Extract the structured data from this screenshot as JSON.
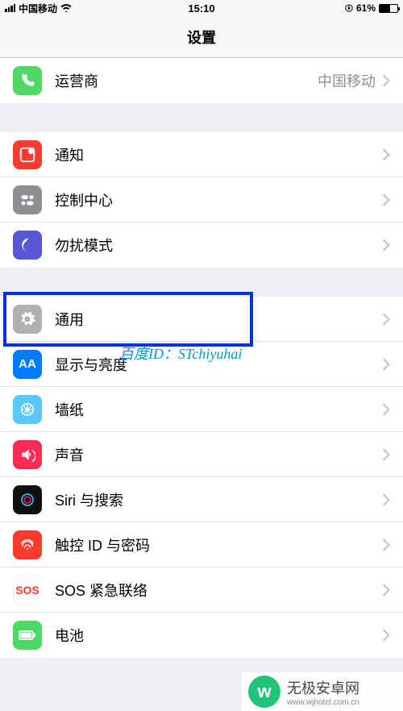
{
  "status": {
    "carrier": "中国移动",
    "time": "15:10",
    "battery_pct": "61%"
  },
  "header": {
    "title": "设置"
  },
  "group1": {
    "carrier": {
      "label": "运营商",
      "detail": "中国移动"
    }
  },
  "group2": {
    "notifications": {
      "label": "通知"
    },
    "control_center": {
      "label": "控制中心"
    },
    "dnd": {
      "label": "勿扰模式"
    }
  },
  "group3": {
    "general": {
      "label": "通用"
    },
    "display": {
      "label": "显示与亮度"
    },
    "wallpaper": {
      "label": "墙纸"
    },
    "sound": {
      "label": "声音"
    },
    "siri": {
      "label": "Siri 与搜索"
    },
    "touchid": {
      "label": "触控 ID 与密码"
    },
    "sos": {
      "label": "SOS 紧急联络"
    },
    "battery": {
      "label": "电池"
    }
  },
  "overlay": {
    "watermark_text": "百度ID：STchiyuhai",
    "footer_brand": "无极安卓网",
    "footer_url": "www.wjhotel.com.cn",
    "footer_logo_letter": "w"
  }
}
